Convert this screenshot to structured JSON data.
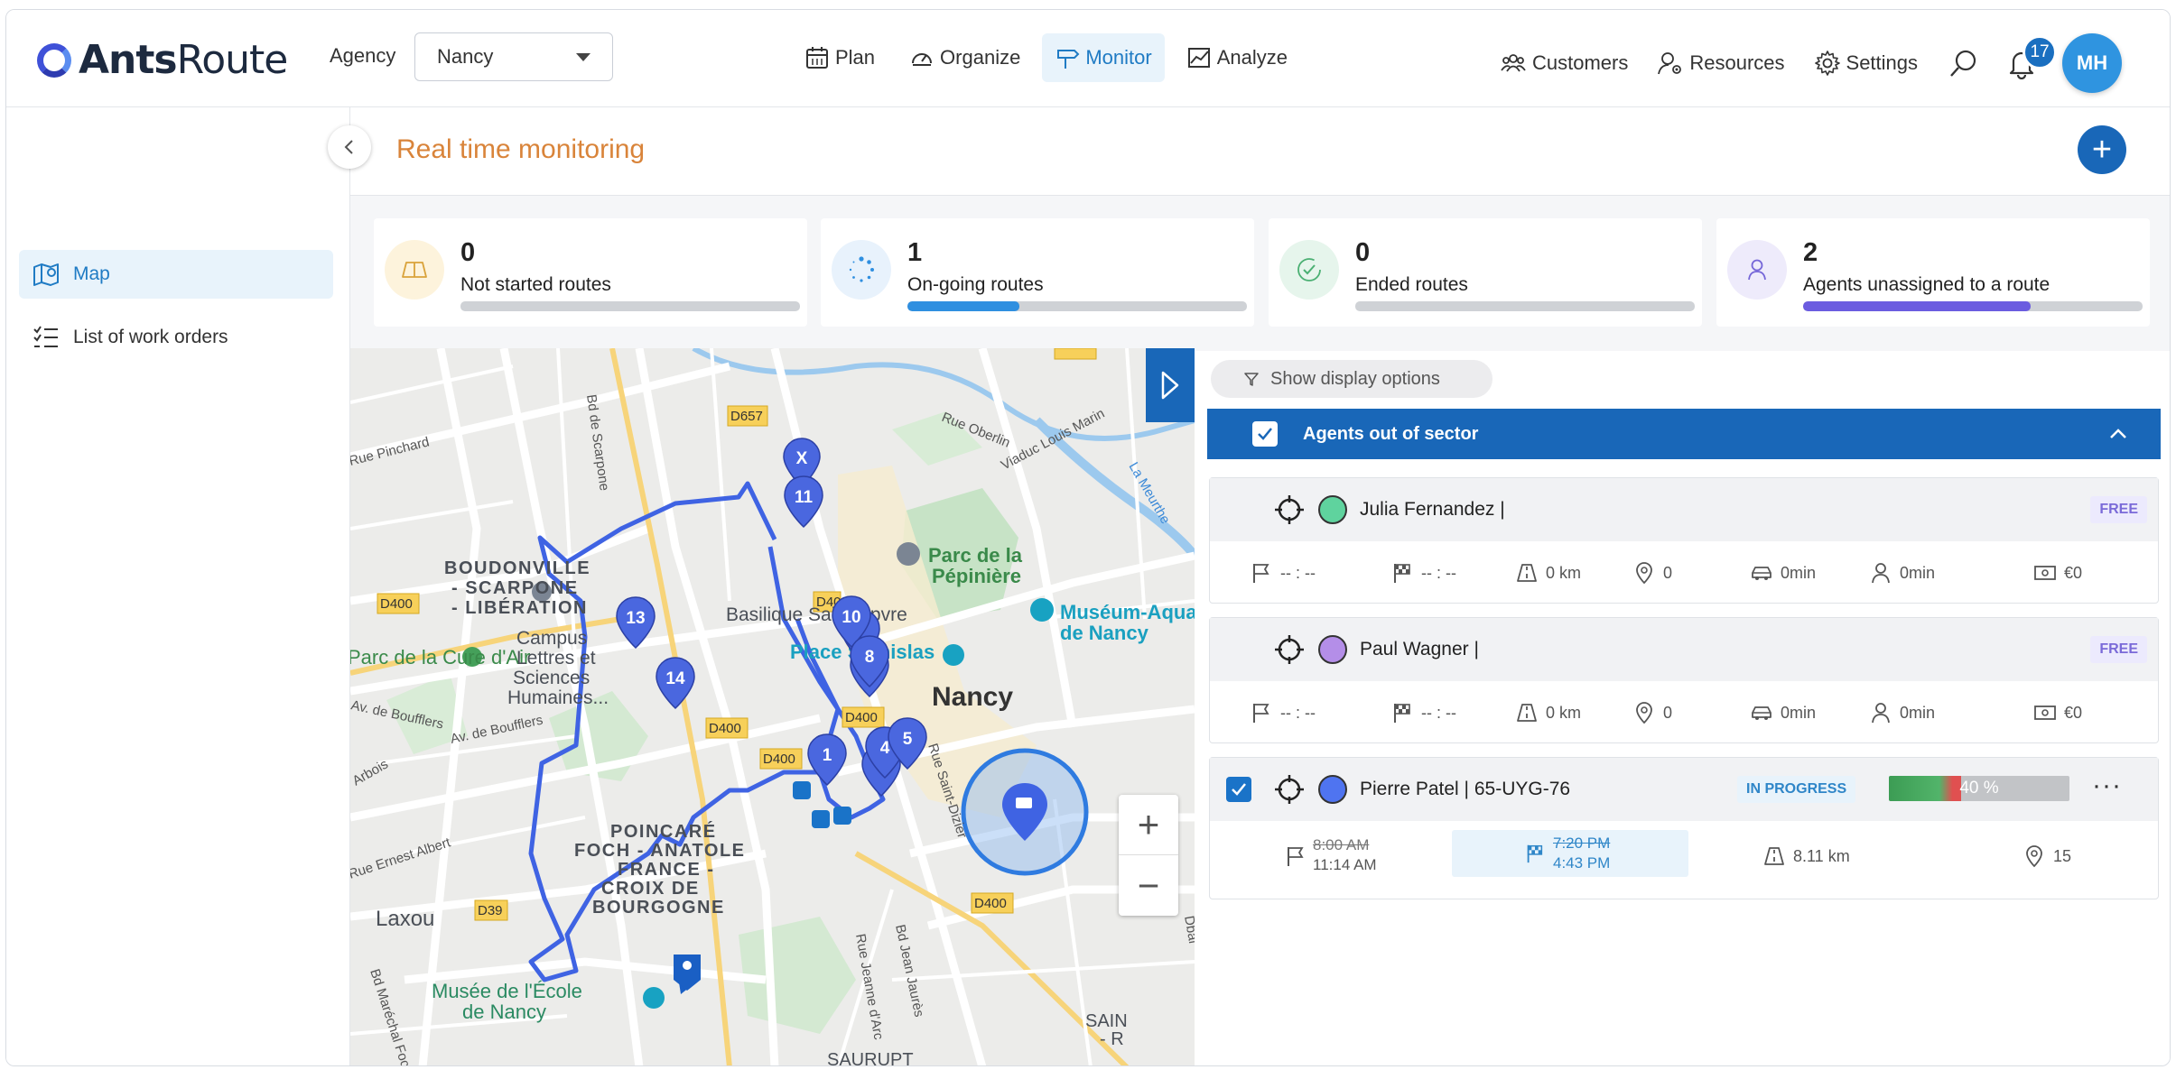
{
  "header": {
    "logo": {
      "part1": "Ants",
      "part2": "Route"
    },
    "agency_label": "Agency",
    "agency_value": "Nancy",
    "nav": [
      {
        "label": "Plan",
        "icon": "calendar-icon"
      },
      {
        "label": "Organize",
        "icon": "gauge-icon"
      },
      {
        "label": "Monitor",
        "icon": "signpost-icon",
        "active": true
      },
      {
        "label": "Analyze",
        "icon": "chart-icon"
      }
    ],
    "right_nav": [
      {
        "label": "Customers",
        "icon": "customers-icon"
      },
      {
        "label": "Resources",
        "icon": "resources-icon"
      },
      {
        "label": "Settings",
        "icon": "gear-icon"
      }
    ],
    "notifications_count": "17",
    "avatar_initials": "MH"
  },
  "sidebar": {
    "items": [
      {
        "label": "Map",
        "icon": "map-icon",
        "active": true
      },
      {
        "label": "List of work orders",
        "icon": "checklist-icon"
      }
    ]
  },
  "page": {
    "title": "Real time monitoring"
  },
  "stats": [
    {
      "value": "0",
      "label": "Not started routes",
      "fill": 0,
      "color": "#cfd2d6",
      "icon_bg": "#fdf3dc",
      "icon_color": "#d9a23a"
    },
    {
      "value": "1",
      "label": "On-going routes",
      "fill": 0.33,
      "color": "#2f8fe0",
      "icon_bg": "#e8f2fc",
      "icon_color": "#2f8fe0"
    },
    {
      "value": "0",
      "label": "Ended routes",
      "fill": 0,
      "color": "#cfd2d6",
      "icon_bg": "#e6f5ec",
      "icon_color": "#4bb073"
    },
    {
      "value": "2",
      "label": "Agents unassigned to a route",
      "fill": 0.67,
      "color": "#6b5ce0",
      "icon_bg": "#eeebfb",
      "icon_color": "#7566d8"
    }
  ],
  "map": {
    "labels": [
      "BOUDONVILLE",
      "- SCARPONE",
      "- LIBÉRATION",
      "Parc de la",
      "Pépinière",
      "Basilique Saint-Epvre",
      "Place Stanislas",
      "Muséum-Aqua",
      "de Nancy",
      "Nancy",
      "Parc de la Cure d'Air",
      "Campus",
      "Lettres et",
      "Sciences",
      "Humaines...",
      "POINCARÉ",
      "FOCH - ANATOLE",
      "FRANCE -",
      "CROIX DE",
      "BOURGOGNE",
      "Laxou",
      "Musée de l'École",
      "de Nancy",
      "Rue Oberlin",
      "Viaduc Louis Marin",
      "La Meurthe",
      "Bd de Scarpone",
      "Rue Pinchard",
      "Av. de Boufflers",
      "Av. de Boufflers",
      "Rue Ernest Albert",
      "Arbois",
      "Rue Saint-Dizier",
      "Bd Jean Jaurès",
      "Rue Jeanne d'Arc",
      "Bd Maréchal Foch",
      "SAIN",
      "- R",
      "SAURUPT",
      "Dbai"
    ],
    "road_badges": [
      "D657",
      "D400",
      "D400",
      "D400",
      "D400",
      "D400",
      "D39",
      "D400",
      "D674"
    ],
    "markers": [
      "X",
      "11",
      "13",
      "14",
      "10",
      "8",
      "1",
      "4",
      "5"
    ],
    "zoom_in": "+",
    "zoom_out": "−"
  },
  "panel": {
    "display_options": "Show display options",
    "sector_title": "Agents out of sector",
    "agents": [
      {
        "name": "Julia Fernandez |",
        "color": "#5fd39e",
        "status": "FREE",
        "start": "-- : --",
        "end": "-- : --",
        "distance": "0 km",
        "stops": "0",
        "drive": "0min",
        "work": "0min",
        "cost": "€0"
      },
      {
        "name": "Paul Wagner |",
        "color": "#b48ee8",
        "status": "FREE",
        "start": "-- : --",
        "end": "-- : --",
        "distance": "0 km",
        "stops": "0",
        "drive": "0min",
        "work": "0min",
        "cost": "€0"
      },
      {
        "name": "Pierre Patel | 65-UYG-76",
        "color": "#4f74f0",
        "status": "IN PROGRESS",
        "progress": "40 %",
        "progress_value": 0.4,
        "start_planned": "8:00 AM",
        "start_actual": "11:14 AM",
        "end_planned": "7:20 PM",
        "end_actual": "4:43 PM",
        "distance": "8.11 km",
        "stops": "15"
      }
    ]
  }
}
